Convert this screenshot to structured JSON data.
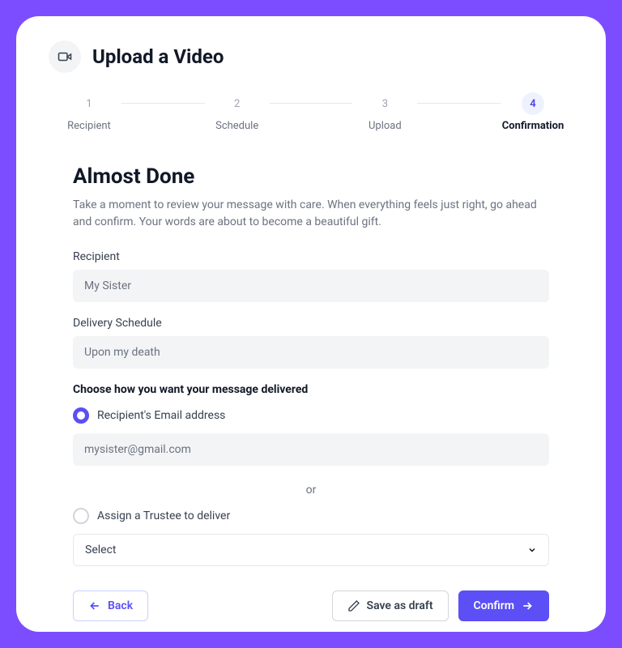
{
  "header": {
    "title": "Upload a Video"
  },
  "stepper": {
    "steps": [
      {
        "num": "1",
        "label": "Recipient"
      },
      {
        "num": "2",
        "label": "Schedule"
      },
      {
        "num": "3",
        "label": "Upload"
      },
      {
        "num": "4",
        "label": "Confirmation"
      }
    ]
  },
  "main": {
    "heading": "Almost Done",
    "subtext": "Take a moment to review your message with care. When everything feels just right, go ahead and confirm. Your words are about to become a beautiful gift.",
    "recipient": {
      "label": "Recipient",
      "value": "My Sister"
    },
    "schedule": {
      "label": "Delivery Schedule",
      "value": "Upon my death"
    },
    "delivery": {
      "section_label": "Choose how you want your message delivered",
      "email_option": "Recipient's Email address",
      "email_value": "mysister@gmail.com",
      "or": "or",
      "trustee_option": "Assign a Trustee to deliver",
      "trustee_select": "Select"
    }
  },
  "footer": {
    "back": "Back",
    "draft": "Save as draft",
    "confirm": "Confirm"
  }
}
